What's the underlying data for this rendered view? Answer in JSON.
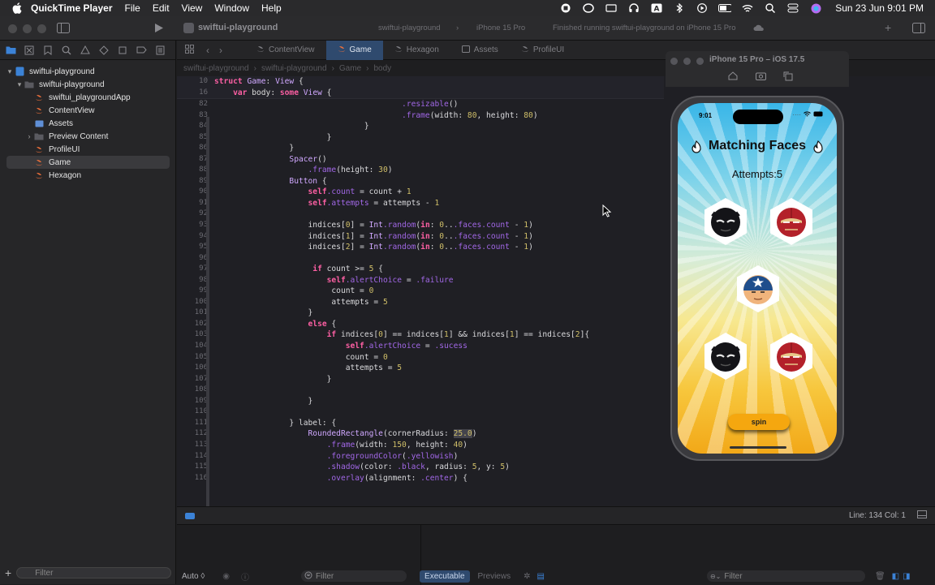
{
  "menubar": {
    "app": "QuickTime Player",
    "menus": [
      "File",
      "Edit",
      "View",
      "Window",
      "Help"
    ],
    "clock": "Sun 23 Jun  9:01 PM"
  },
  "toolbar": {
    "project": "swiftui-playground",
    "scheme_project": "swiftui-playground",
    "scheme_device": "iPhone 15 Pro",
    "run_status": "Finished running swiftui-playground on iPhone 15 Pro"
  },
  "navigator": {
    "items": [
      {
        "label": "swiftui-playground",
        "indent": 0,
        "chev": "v",
        "icon": "project-icon"
      },
      {
        "label": "swiftui-playground",
        "indent": 1,
        "chev": "v",
        "icon": "folder-icon"
      },
      {
        "label": "swiftui_playgroundApp",
        "indent": 2,
        "chev": "",
        "icon": "swift-file-icon"
      },
      {
        "label": "ContentView",
        "indent": 2,
        "chev": "",
        "icon": "swift-file-icon"
      },
      {
        "label": "Assets",
        "indent": 2,
        "chev": "",
        "icon": "assets-icon"
      },
      {
        "label": "Preview Content",
        "indent": 2,
        "chev": ">",
        "icon": "folder-icon"
      },
      {
        "label": "ProfileUI",
        "indent": 2,
        "chev": "",
        "icon": "swift-file-icon"
      },
      {
        "label": "Game",
        "indent": 2,
        "chev": "",
        "icon": "swift-file-icon",
        "selected": true
      },
      {
        "label": "Hexagon",
        "indent": 2,
        "chev": "",
        "icon": "swift-file-icon"
      }
    ],
    "filter_placeholder": "Filter"
  },
  "tabs": [
    "ContentView",
    "Game",
    "Hexagon",
    "Assets",
    "ProfileUI"
  ],
  "active_tab": "Game",
  "jumpbar": [
    "swiftui-playground",
    "swiftui-playground",
    "Game",
    "body"
  ],
  "sticky": [
    {
      "n": "10",
      "code": "struct Game: View {"
    },
    {
      "n": "16",
      "code": "    var body: some View {"
    }
  ],
  "lines": [
    {
      "n": "82",
      "code": "                                        .resizable()"
    },
    {
      "n": "83",
      "code": "                                        .frame(width: 80, height: 80)"
    },
    {
      "n": "84",
      "code": "                                }"
    },
    {
      "n": "85",
      "code": "                        }"
    },
    {
      "n": "86",
      "code": "                }"
    },
    {
      "n": "87",
      "code": "                Spacer()"
    },
    {
      "n": "88",
      "code": "                    .frame(height: 30)"
    },
    {
      "n": "89",
      "code": "                Button {"
    },
    {
      "n": "90",
      "code": "                    self.count = count + 1"
    },
    {
      "n": "91",
      "code": "                    self.attempts = attempts - 1"
    },
    {
      "n": "92",
      "code": ""
    },
    {
      "n": "93",
      "code": "                    indices[0] = Int.random(in: 0...faces.count - 1)"
    },
    {
      "n": "94",
      "code": "                    indices[1] = Int.random(in: 0...faces.count - 1)"
    },
    {
      "n": "95",
      "code": "                    indices[2] = Int.random(in: 0...faces.count - 1)"
    },
    {
      "n": "96",
      "code": ""
    },
    {
      "n": "97",
      "code": "                     if count >= 5 {"
    },
    {
      "n": "98",
      "code": "                        self.alertChoice = .failure"
    },
    {
      "n": "99",
      "code": "                         count = 0"
    },
    {
      "n": "100",
      "code": "                         attempts = 5"
    },
    {
      "n": "101",
      "code": "                    }"
    },
    {
      "n": "102",
      "code": "                    else {"
    },
    {
      "n": "103",
      "code": "                        if indices[0] == indices[1] && indices[1] == indices[2]{"
    },
    {
      "n": "104",
      "code": "                            self.alertChoice = .sucess"
    },
    {
      "n": "105",
      "code": "                            count = 0"
    },
    {
      "n": "106",
      "code": "                            attempts = 5"
    },
    {
      "n": "107",
      "code": "                        }"
    },
    {
      "n": "108",
      "code": ""
    },
    {
      "n": "109",
      "code": "                    }"
    },
    {
      "n": "110",
      "code": ""
    },
    {
      "n": "111",
      "code": "                } label: {"
    },
    {
      "n": "112",
      "code": "                    RoundedRectangle(cornerRadius: 25.0)"
    },
    {
      "n": "113",
      "code": "                        .frame(width: 150, height: 40)"
    },
    {
      "n": "114",
      "code": "                        .foregroundColor(.yellowish)"
    },
    {
      "n": "115",
      "code": "                        .shadow(color: .black, radius: 5, y: 5)"
    },
    {
      "n": "116",
      "code": "                        .overlay(alignment: .center) {"
    }
  ],
  "status": {
    "position": "Line: 134  Col: 1"
  },
  "bottom": {
    "auto": "Auto ◊",
    "filter1": "Filter",
    "executable": "Executable",
    "previews": "Previews",
    "filter2": "Filter"
  },
  "simulator": {
    "title": "iPhone 15 Pro – iOS 17.5",
    "time": "9:01",
    "game_title": "Matching Faces",
    "attempts": "Attempts:5",
    "spin": "spin"
  },
  "colors": {
    "accent": "#2f4a6e",
    "spin": "#f5a70f",
    "keyword": "#fc5fa3"
  }
}
